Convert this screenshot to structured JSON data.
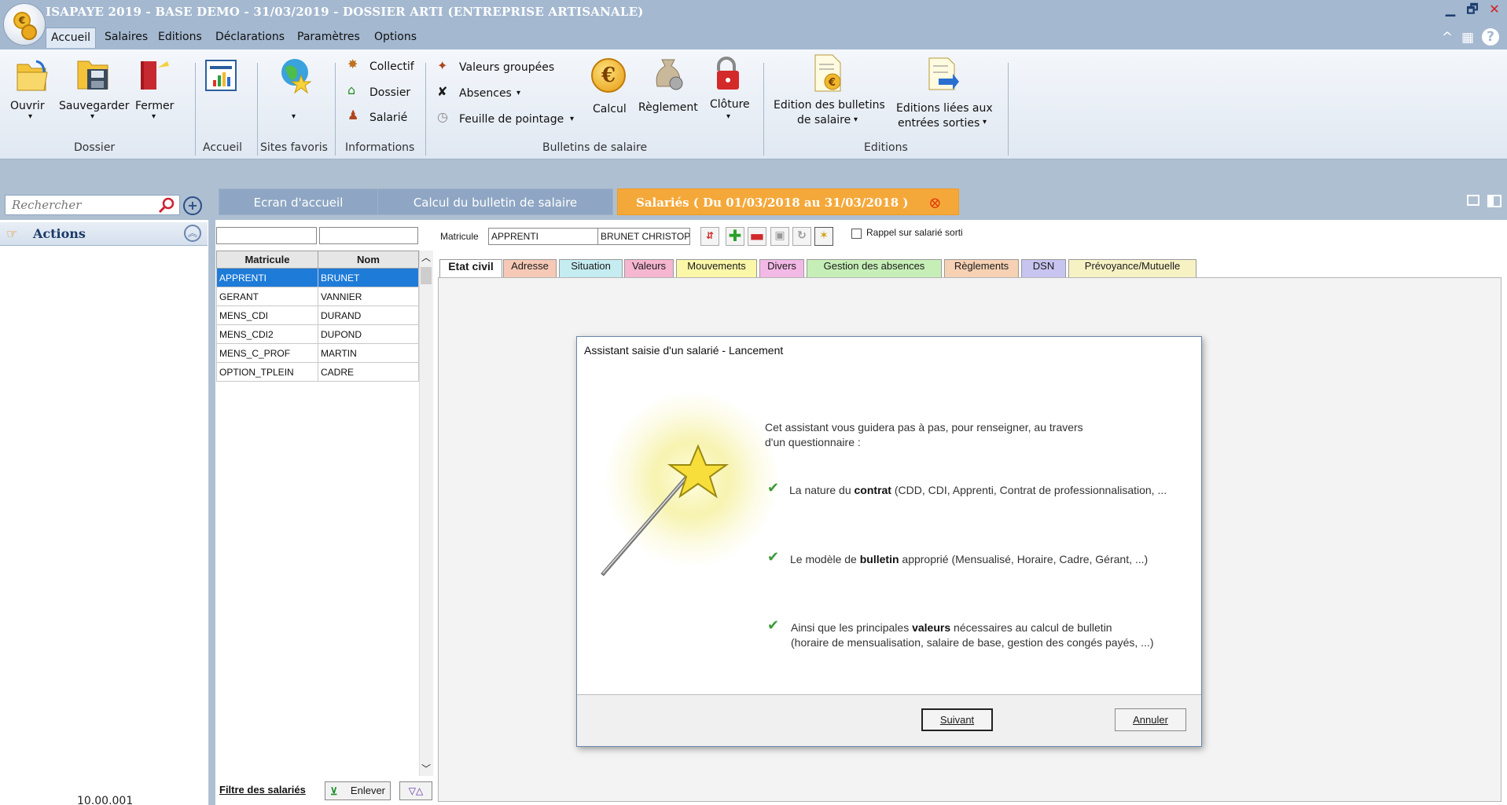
{
  "window": {
    "title": "ISAPAYE 2019 - BASE DEMO - 31/03/2019 - DOSSIER ARTI (ENTREPRISE ARTISANALE)",
    "logo_text": "€"
  },
  "menu": [
    "Accueil",
    "Salaires",
    "Editions",
    "Déclarations",
    "Paramètres",
    "Options"
  ],
  "window_controls": {
    "minimize": "▁",
    "restore": "🗗",
    "close": "✕",
    "collapse": "^",
    "calc": "▦",
    "help": "?"
  },
  "ribbon": {
    "dossier": {
      "open": "Ouvrir",
      "save": "Sauvegarder",
      "close": "Fermer",
      "group": "Dossier"
    },
    "accueil": {
      "group": "Accueil"
    },
    "sites": {
      "group": "Sites favoris"
    },
    "informations": {
      "collectif": "Collectif",
      "dossier": "Dossier",
      "salarie": "Salarié",
      "group": "Informations"
    },
    "bulletins": {
      "valeurs": "Valeurs groupées",
      "absences": "Absences",
      "feuille": "Feuille de pointage",
      "calcul": "Calcul",
      "reglement": "Règlement",
      "cloture": "Clôture",
      "group": "Bulletins de salaire"
    },
    "editions": {
      "bulletins_l1": "Edition des bulletins",
      "bulletins_l2": "de salaire",
      "liees_l1": "Editions liées aux",
      "liees_l2": "entrées sorties",
      "group": "Editions"
    },
    "dropdown_arrow": "▾"
  },
  "doc_tabs": [
    "Ecran d'accueil",
    "Calcul du bulletin de salaire",
    "Salariés ( Du 01/03/2018 au 31/03/2018 )"
  ],
  "doc_tab_close": "⊗",
  "left_pane": {
    "search_placeholder": "Rechercher",
    "actions_label": "Actions",
    "version": "10.00.001"
  },
  "employee_list": {
    "columns": [
      "Matricule",
      "Nom"
    ],
    "rows": [
      {
        "matricule": "APPRENTI",
        "nom": "BRUNET"
      },
      {
        "matricule": "GERANT",
        "nom": "VANNIER"
      },
      {
        "matricule": "MENS_CDI",
        "nom": "DURAND"
      },
      {
        "matricule": "MENS_CDI2",
        "nom": "DUPOND"
      },
      {
        "matricule": "MENS_C_PROF",
        "nom": "MARTIN"
      },
      {
        "matricule": "OPTION_TPLEIN",
        "nom": "CADRE"
      }
    ],
    "selected_index": 0,
    "filter_link": "Filtre des salariés",
    "remove_button": "Enlever",
    "sort_symbol": "▽△"
  },
  "employee_form": {
    "matricule_label": "Matricule",
    "matricule_value": "APPRENTI",
    "name_value": "BRUNET CHRISTOP",
    "rappel_label": "Rappel sur salarié sorti",
    "tabs": [
      {
        "label": "Etat civil",
        "color": "#ffffff"
      },
      {
        "label": "Adresse",
        "color": "#f6c9b6"
      },
      {
        "label": "Situation",
        "color": "#c5ecf1"
      },
      {
        "label": "Valeurs",
        "color": "#f6b6cf"
      },
      {
        "label": "Mouvements",
        "color": "#fbf7a8"
      },
      {
        "label": "Divers",
        "color": "#f3b9e6"
      },
      {
        "label": "Gestion des absences",
        "color": "#c6efb8"
      },
      {
        "label": "Règlements",
        "color": "#f6d1b4"
      },
      {
        "label": "DSN",
        "color": "#c7c5f0"
      },
      {
        "label": "Prévoyance/Mutuelle",
        "color": "#f7f2c4"
      }
    ]
  },
  "dialog": {
    "title": "Assistant saisie d'un salarié - Lancement",
    "intro_l1": "Cet assistant vous guidera pas à pas, pour renseigner, au travers",
    "intro_l2": "d'un questionnaire :",
    "item1_pre": "La nature du ",
    "item1_bold": "contrat",
    "item1_post": " (CDD, CDI, Apprenti, Contrat de professionnalisation, ...",
    "item2_pre": "Le modèle de ",
    "item2_bold": "bulletin",
    "item2_post": " approprié (Mensualisé, Horaire, Cadre, Gérant, ...)",
    "item3_pre": "Ainsi que les principales ",
    "item3_bold": "valeurs",
    "item3_post": " nécessaires au calcul de bulletin",
    "item3_l2": "(horaire de mensualisation, salaire de base, gestion des congés payés, ...)",
    "next_button": "Suivant",
    "cancel_button": "Annuler"
  }
}
